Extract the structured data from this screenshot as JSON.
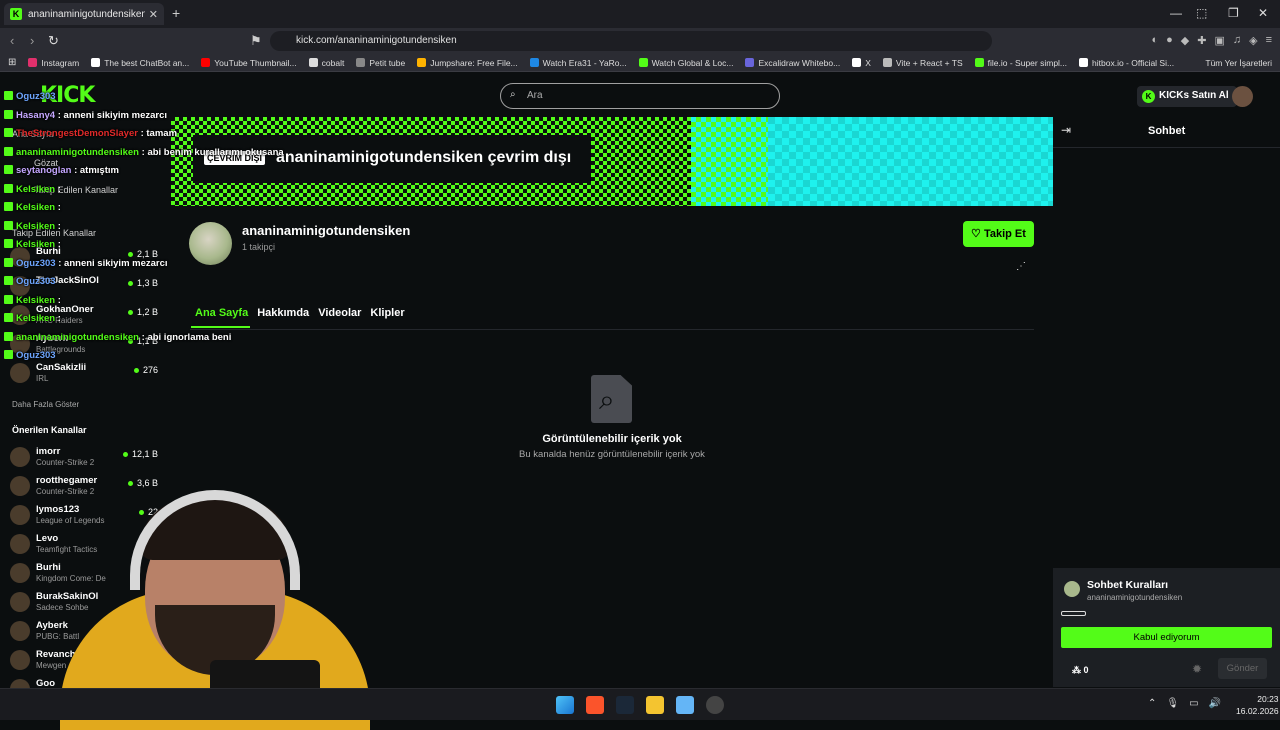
{
  "browser": {
    "tab_title": "ananinaminigotundensiken Stre",
    "url": "kick.com/ananinaminigotundensiken",
    "bookmarks": [
      {
        "label": "Instagram",
        "color": "#e1306c"
      },
      {
        "label": "The best ChatBot an...",
        "color": "#ffffff"
      },
      {
        "label": "YouTube Thumbnail...",
        "color": "#ff0000"
      },
      {
        "label": "cobalt",
        "color": "#dddddd"
      },
      {
        "label": "Petit tube",
        "color": "#888888"
      },
      {
        "label": "Jumpshare: Free File...",
        "color": "#ffb300"
      },
      {
        "label": "Watch Era31 - YaRo...",
        "color": "#1e88e5"
      },
      {
        "label": "Watch Global & Loc...",
        "color": "#53fc18"
      },
      {
        "label": "Excalidraw Whitebo...",
        "color": "#6965db"
      },
      {
        "label": "X",
        "color": "#ffffff"
      },
      {
        "label": "Vite + React + TS",
        "color": "#bbbbbb"
      },
      {
        "label": "file.io - Super simpl...",
        "color": "#53fc18"
      },
      {
        "label": "hitbox.io - Official Si...",
        "color": "#ffffff"
      }
    ],
    "bookmarks_right": "Tüm Yer İşaretleri"
  },
  "site": {
    "logo": "KICK",
    "search_placeholder": "Ara",
    "kicks_button": "KICKs Satın Al"
  },
  "sidebar": {
    "nav_home": "Ana Sayfa",
    "nav_browse": "Gözat",
    "nav_following": "Takip Edilen Kanallar",
    "followed_header": "Takip Edilen Kanallar",
    "followed": [
      {
        "name": "Burhi",
        "game": "",
        "viewers": "2,1 B"
      },
      {
        "name": "TheJackSinOl",
        "game": "",
        "viewers": "1,3 B"
      },
      {
        "name": "GokhanOner",
        "game": "ARC Raiders",
        "viewers": "1,2 B"
      },
      {
        "name": "Ayberk",
        "game": "Battlegrounds",
        "viewers": "1,1 B"
      },
      {
        "name": "CanSakizlii",
        "game": "IRL",
        "viewers": "276"
      }
    ],
    "show_more": "Daha Fazla Göster",
    "recommended_header": "Önerilen Kanallar",
    "recommended": [
      {
        "name": "imorr",
        "game": "Counter-Strike 2",
        "viewers": "12,1 B"
      },
      {
        "name": "rootthegamer",
        "game": "Counter-Strike 2",
        "viewers": "3,6 B"
      },
      {
        "name": "lymos123",
        "game": "League of Legends",
        "viewers": "22"
      },
      {
        "name": "Levo",
        "game": "Teamfight Tactics",
        "viewers": ""
      },
      {
        "name": "Burhi",
        "game": "Kingdom Come: De",
        "viewers": ""
      },
      {
        "name": "BurakSakinOl",
        "game": "Sadece Sohbe",
        "viewers": ""
      },
      {
        "name": "Ayberk",
        "game": "PUBG: Battl",
        "viewers": ""
      },
      {
        "name": "Revanch",
        "game": "Mewgen",
        "viewers": ""
      },
      {
        "name": "Goo",
        "game": "",
        "viewers": ""
      }
    ]
  },
  "overlay_chat": [
    {
      "user": "Oguz303",
      "color": "#6ea6ff",
      "msg": ""
    },
    {
      "user": "Hasany4",
      "color": "#c4a7ff",
      "msg": ": anneni sikiyim mezarcı"
    },
    {
      "user": "TheStrongestDemonSlayer",
      "color": "#e02a2a",
      "msg": ": tamam"
    },
    {
      "user": "ananinaminigotundensiken",
      "color": "#53fc18",
      "msg": ": abi benim kurallarımı okusana"
    },
    {
      "user": "seytanoglan",
      "color": "#c4a7ff",
      "msg": ": atmıştım"
    },
    {
      "user": "Kelsiken",
      "color": "#53fc18",
      "msg": ":"
    },
    {
      "user": "Kelsiken",
      "color": "#53fc18",
      "msg": ":"
    },
    {
      "user": "Kelsiken",
      "color": "#53fc18",
      "msg": ":"
    },
    {
      "user": "Kelsiken",
      "color": "#53fc18",
      "msg": ":"
    },
    {
      "user": "Oguz303",
      "color": "#6ea6ff",
      "msg": ": anneni sikiyim mezarcı"
    },
    {
      "user": "Oguz303",
      "color": "#6ea6ff",
      "msg": ""
    },
    {
      "user": "Kelsiken",
      "color": "#53fc18",
      "msg": ":"
    },
    {
      "user": "Kelsiken",
      "color": "#53fc18",
      "msg": ":"
    },
    {
      "user": "ananinaminigotundensiken",
      "color": "#53fc18",
      "msg": ": abi ignorlama beni"
    },
    {
      "user": "Oguz303",
      "color": "#6ea6ff",
      "msg": ""
    }
  ],
  "channel": {
    "offline_badge": "ÇEVRİM DIŞI",
    "offline_title": "ananinaminigotundensiken çevrim dışı",
    "name": "ananinaminigotundensiken",
    "followers": "1 takipçi",
    "follow_button": "Takip Et",
    "tabs": [
      "Ana Sayfa",
      "Hakkımda",
      "Videolar",
      "Klipler"
    ],
    "empty_title": "Görüntülenebilir içerik yok",
    "empty_sub": "Bu kanalda henüz görüntülenebilir içerik yok"
  },
  "chat": {
    "title": "Sohbet",
    "rules_title": "Sohbet Kuralları",
    "rules_channel": "ananinaminigotundensiken",
    "accept": "Kabul ediyorum",
    "points": "0",
    "send": "Gönder"
  },
  "taskbar": {
    "time": "20:23",
    "date": "16.02.2026"
  }
}
